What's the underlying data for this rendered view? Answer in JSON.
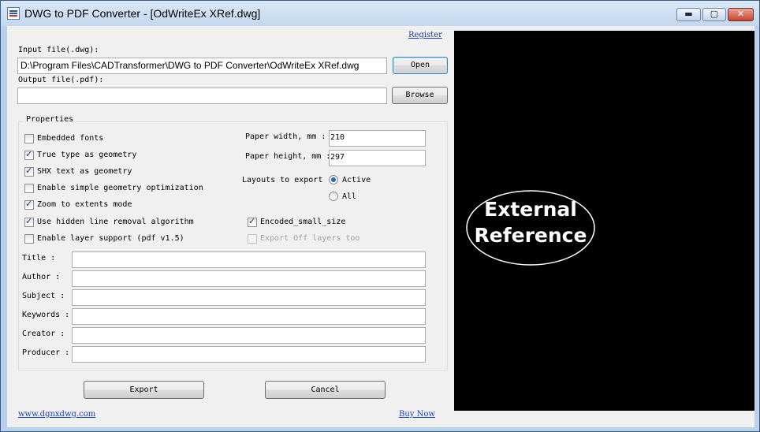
{
  "window": {
    "title": "DWG to PDF Converter - [OdWriteEx XRef.dwg]",
    "controls": {
      "minimize": "▬",
      "maximize": "▢",
      "close": "✕"
    }
  },
  "header": {
    "register_link": "Register"
  },
  "input": {
    "label": "Input file(.dwg):",
    "value": "D:\\Program Files\\CADTransformer\\DWG to PDF Converter\\OdWriteEx XRef.dwg",
    "open_button": "Open"
  },
  "output": {
    "label": "Output file(.pdf):",
    "value": "",
    "browse_button": "Browse"
  },
  "properties": {
    "title": "Properties",
    "options": [
      {
        "label": "Embedded fonts",
        "checked": false
      },
      {
        "label": "True type as geometry",
        "checked": true
      },
      {
        "label": "SHX text as geometry",
        "checked": true
      },
      {
        "label": "Enable simple geometry optimization",
        "checked": false
      },
      {
        "label": "Zoom to extents mode",
        "checked": true
      },
      {
        "label": "Use hidden line removal algorithm",
        "checked": true
      },
      {
        "label": "Enable layer support (pdf v1.5)",
        "checked": false
      }
    ],
    "paper_width_label": "Paper width, mm :",
    "paper_width_value": "210",
    "paper_height_label": "Paper height, mm :",
    "paper_height_value": "297",
    "layouts_label": "Layouts to export",
    "layouts_options": [
      {
        "label": "Active",
        "selected": true
      },
      {
        "label": "All",
        "selected": false
      }
    ],
    "encoded_small_size": {
      "label": "Encoded_small_size",
      "checked": true
    },
    "export_off_layers": {
      "label": "Export Off layers too",
      "checked": false,
      "enabled": false
    },
    "metadata": [
      {
        "label": "Title :",
        "value": ""
      },
      {
        "label": "Author :",
        "value": ""
      },
      {
        "label": "Subject :",
        "value": ""
      },
      {
        "label": "Keywords :",
        "value": ""
      },
      {
        "label": "Creator :",
        "value": ""
      },
      {
        "label": "Producer :",
        "value": ""
      }
    ]
  },
  "actions": {
    "export_button": "Export",
    "cancel_button": "Cancel"
  },
  "footer": {
    "website_link": "www.dgnxdwg.com",
    "buy_link": "Buy Now"
  },
  "preview": {
    "text_line1": "External",
    "text_line2": "Reference",
    "background_color": "#000000",
    "foreground_color": "#ffffff"
  }
}
